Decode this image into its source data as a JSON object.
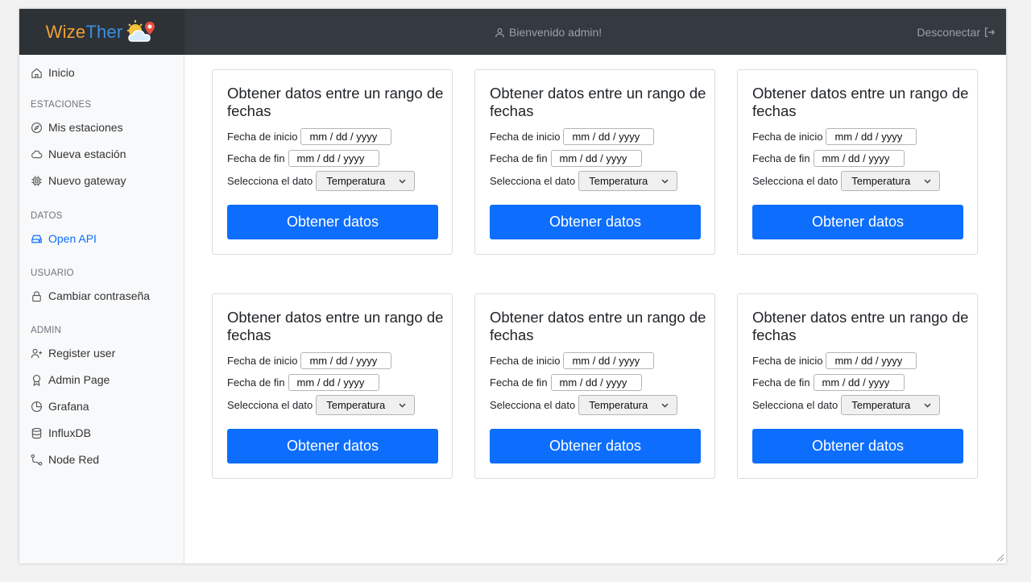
{
  "brand": {
    "part1": "Wize",
    "part2": "Ther"
  },
  "header": {
    "welcome": "Bienvenido admin!",
    "logout": "Desconectar"
  },
  "sidebar": {
    "home": "Inicio",
    "sections": {
      "estaciones": "ESTACIONES",
      "datos": "DATOS",
      "usuario": "USUARIO",
      "admin": "ADMIN"
    },
    "items": {
      "mis_estaciones": "Mis estaciones",
      "nueva_estacion": "Nueva estación",
      "nuevo_gateway": "Nuevo gateway",
      "open_api": "Open API",
      "cambiar_contrasena": "Cambiar contraseña",
      "register_user": "Register user",
      "admin_page": "Admin Page",
      "grafana": "Grafana",
      "influxdb": "InfluxDB",
      "node_red": "Node Red"
    }
  },
  "cards": [
    {
      "title": "Obtener datos entre un rango de fechas",
      "start_label": "Fecha de inicio",
      "start_value": "mm / dd / yyyy",
      "end_label": "Fecha de fin",
      "end_value": "mm / dd / yyyy",
      "select_label": "Selecciona el dato",
      "select_value": "Temperatura",
      "button": "Obtener datos"
    },
    {
      "title": "Obtener datos entre un rango de fechas",
      "start_label": "Fecha de inicio",
      "start_value": "mm / dd / yyyy",
      "end_label": "Fecha de fin",
      "end_value": "mm / dd / yyyy",
      "select_label": "Selecciona el dato",
      "select_value": "Temperatura",
      "button": "Obtener datos"
    },
    {
      "title": "Obtener datos entre un rango de fechas",
      "start_label": "Fecha de inicio",
      "start_value": "mm / dd / yyyy",
      "end_label": "Fecha de fin",
      "end_value": "mm / dd / yyyy",
      "select_label": "Selecciona el dato",
      "select_value": "Temperatura",
      "button": "Obtener datos"
    },
    {
      "title": "Obtener datos entre un rango de fechas",
      "start_label": "Fecha de inicio",
      "start_value": "mm / dd / yyyy",
      "end_label": "Fecha de fin",
      "end_value": "mm / dd / yyyy",
      "select_label": "Selecciona el dato",
      "select_value": "Temperatura",
      "button": "Obtener datos"
    },
    {
      "title": "Obtener datos entre un rango de fechas",
      "start_label": "Fecha de inicio",
      "start_value": "mm / dd / yyyy",
      "end_label": "Fecha de fin",
      "end_value": "mm / dd / yyyy",
      "select_label": "Selecciona el dato",
      "select_value": "Temperatura",
      "button": "Obtener datos"
    },
    {
      "title": "Obtener datos entre un rango de fechas",
      "start_label": "Fecha de inicio",
      "start_value": "mm / dd / yyyy",
      "end_label": "Fecha de fin",
      "end_value": "mm / dd / yyyy",
      "select_label": "Selecciona el dato",
      "select_value": "Temperatura",
      "button": "Obtener datos"
    }
  ],
  "colors": {
    "header_bg": "#343a40",
    "primary": "#0d6efd",
    "brand_orange": "#f0a030",
    "brand_blue": "#3a8fe0"
  },
  "icons": {
    "home": "home-icon",
    "compass": "compass-icon",
    "cloud": "cloud-icon",
    "chip": "chip-icon",
    "drive": "drive-icon",
    "lock": "lock-icon",
    "user_plus": "user-plus-icon",
    "award": "award-icon",
    "pie": "pie-chart-icon",
    "database": "database-icon",
    "route": "route-icon",
    "user": "user-icon",
    "logout": "logout-icon",
    "logo": "weather-logo-icon"
  }
}
